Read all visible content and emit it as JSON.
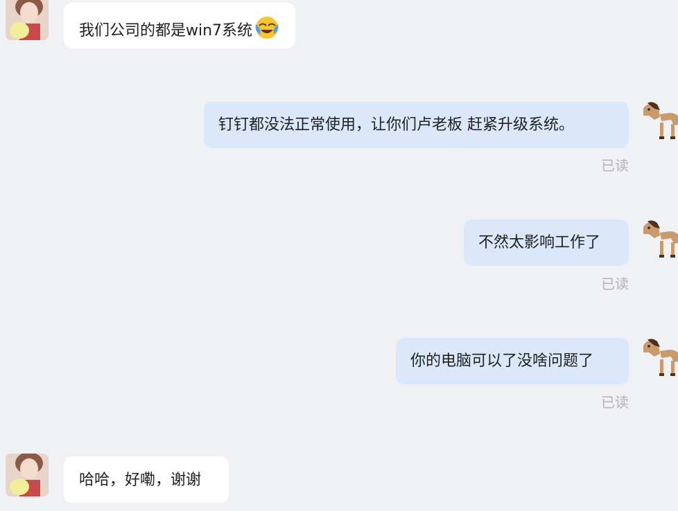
{
  "messages": [
    {
      "side": "left",
      "text": "我们公司的都是win7系统",
      "emoji": "crying-laughing-emoji"
    },
    {
      "side": "right",
      "text": "钉钉都没法正常使用，让你们卢老板 赶紧升级系统。",
      "status": "已读"
    },
    {
      "side": "right",
      "text": "不然太影响工作了",
      "status": "已读"
    },
    {
      "side": "right",
      "text": "你的电脑可以了没啥问题了",
      "status": "已读"
    },
    {
      "side": "left",
      "text": "哈哈，好嘞，谢谢"
    }
  ],
  "colors": {
    "background": "#f0f1f4",
    "incoming_bubble": "#ffffff",
    "outgoing_bubble": "#dbe8fb",
    "read_status": "#b4b4b4"
  }
}
